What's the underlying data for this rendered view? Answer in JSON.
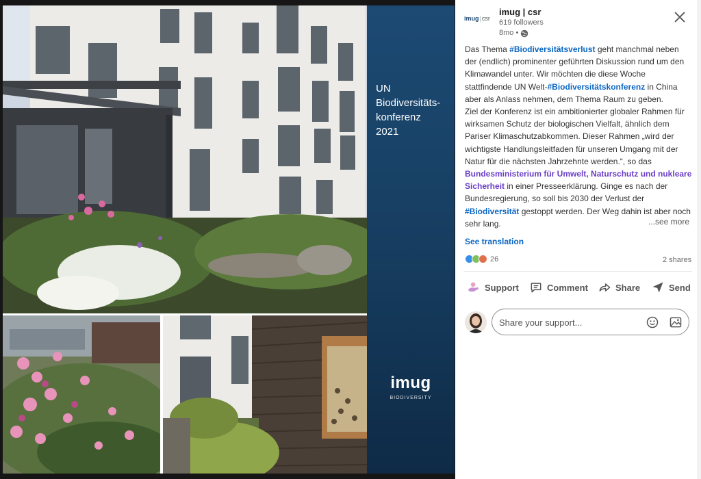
{
  "media": {
    "brand_title_lines": [
      "UN",
      "Biodiversitäts-",
      "konferenz",
      "2021"
    ],
    "brand_logo_word": "imug",
    "brand_logo_sub": "BIODIVERSITY"
  },
  "author": {
    "logo_main": "imug",
    "logo_sep": "|",
    "logo_csr": "csr",
    "name": "imug | csr",
    "followers": "619 followers",
    "age": "8mo •",
    "visibility_icon": "globe-icon"
  },
  "post": {
    "segments": [
      {
        "type": "text",
        "value": "Das Thema "
      },
      {
        "type": "tag",
        "value": "#Biodiversitätsverlust"
      },
      {
        "type": "text",
        "value": " geht manchmal neben der (endlich) prominenter geführten Diskussion rund um den Klimawandel unter. Wir möchten die diese Woche stattfindende UN Welt-"
      },
      {
        "type": "tag",
        "value": "#Biodiversitätskonferenz"
      },
      {
        "type": "text",
        "value": " in China aber als Anlass nehmen, dem Thema Raum zu geben."
      },
      {
        "type": "br"
      },
      {
        "type": "text",
        "value": "Ziel der Konferenz ist ein ambitionierter globaler Rahmen für wirksamen Schutz der biologischen Vielfalt, ähnlich dem Pariser Klimaschutzabkommen. Dieser Rahmen „wird der wichtigste Handlungsleitfaden für unseren Umgang mit der Natur für die nächsten Jahrzehnte werden.“, so das "
      },
      {
        "type": "mention",
        "value": "Bundesministerium für Umwelt, Naturschutz und nukleare Sicherheit"
      },
      {
        "type": "text",
        "value": " in einer Presseerklärung. Ginge es nach der Bundesregierung, so soll bis 2030 der Verlust der "
      },
      {
        "type": "tag",
        "value": "#Biodiversität"
      },
      {
        "type": "text",
        "value": " gestoppt werden. Der Weg dahin ist aber noch sehr lang."
      }
    ],
    "see_more": "...see more",
    "see_translation": "See translation"
  },
  "social": {
    "reaction_count": "26",
    "shares": "2 shares",
    "reaction_colors": [
      "#378fe9",
      "#7fc15e",
      "#df704d"
    ]
  },
  "actions": {
    "support": "Support",
    "comment": "Comment",
    "share": "Share",
    "send": "Send"
  },
  "comment_box": {
    "placeholder": "Share your support..."
  },
  "colors": {
    "accent": "#0a66c2",
    "mention": "#6a3ec7",
    "brand_panel": "#173e61"
  }
}
